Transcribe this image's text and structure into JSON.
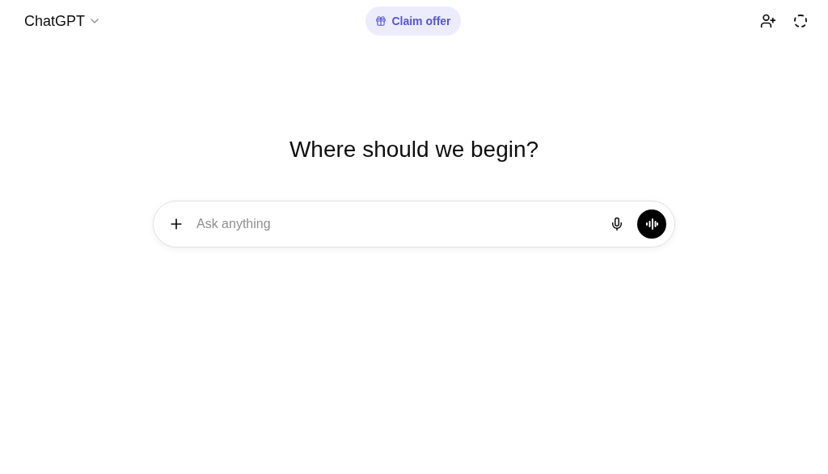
{
  "header": {
    "model": "ChatGPT",
    "offer_button": "Claim offer"
  },
  "heading": "Where should we begin?",
  "composer": {
    "placeholder": "Ask anything"
  }
}
